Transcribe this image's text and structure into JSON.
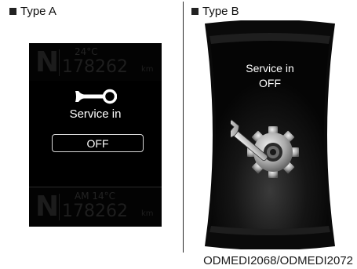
{
  "captions": {
    "type_a": "Type A",
    "type_b": "Type B"
  },
  "type_a": {
    "ghost_top_small": "24°C",
    "ghost_top_odometer": "178262",
    "ghost_top_unit": "km",
    "ghost_gear": "N",
    "service_text": "Service in",
    "off_label": "OFF",
    "ghost_bottom_small": "AM 14°C",
    "ghost_bottom_odometer": "178262",
    "ghost_bottom_unit": "km",
    "icon": "wrench-icon"
  },
  "type_b": {
    "service_line1": "Service in",
    "service_line2": "OFF",
    "icon": "gear-wrench-icon"
  },
  "figure_code": "ODMEDI2068/ODMEDI2072",
  "colors": {
    "display_background": "#000000",
    "display_text": "#ffffff",
    "caption_text": "#111111"
  }
}
